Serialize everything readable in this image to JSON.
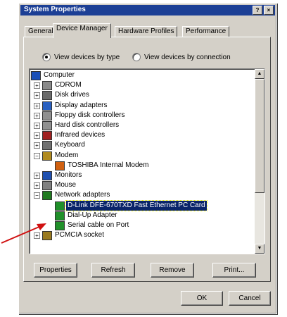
{
  "window": {
    "title": "System Properties",
    "help_button": "?",
    "close_button": "×"
  },
  "tabs": [
    {
      "label": "General"
    },
    {
      "label": "Device Manager",
      "active": true
    },
    {
      "label": "Hardware Profiles"
    },
    {
      "label": "Performance"
    }
  ],
  "view_options": {
    "by_type": {
      "label": "View devices by type",
      "selected": true
    },
    "by_connection": {
      "label": "View devices by connection",
      "selected": false
    }
  },
  "tree": {
    "items": [
      {
        "label": "Computer",
        "icon": "computer-icon",
        "expander": ""
      },
      {
        "label": "CDROM",
        "icon": "cdrom-icon",
        "expander": "+"
      },
      {
        "label": "Disk drives",
        "icon": "disk-drive-icon",
        "expander": "+"
      },
      {
        "label": "Display adapters",
        "icon": "display-adapter-icon",
        "expander": "+"
      },
      {
        "label": "Floppy disk controllers",
        "icon": "floppy-controller-icon",
        "expander": "+"
      },
      {
        "label": "Hard disk controllers",
        "icon": "hard-disk-controller-icon",
        "expander": "+"
      },
      {
        "label": "Infrared devices",
        "icon": "infrared-icon",
        "expander": "+"
      },
      {
        "label": "Keyboard",
        "icon": "keyboard-icon",
        "expander": "+"
      },
      {
        "label": "Modem",
        "icon": "modem-icon",
        "expander": "−"
      },
      {
        "label": "TOSHIBA Internal Modem",
        "icon": "modem-device-icon",
        "expander": ""
      },
      {
        "label": "Monitors",
        "icon": "monitor-icon",
        "expander": "+"
      },
      {
        "label": "Mouse",
        "icon": "mouse-icon",
        "expander": "+"
      },
      {
        "label": "Network adapters",
        "icon": "network-adapter-icon",
        "expander": "−"
      },
      {
        "label": "D-Link DFE-670TXD Fast Ethernet PC Card",
        "icon": "network-card-icon",
        "expander": "",
        "selected": true
      },
      {
        "label": "Dial-Up Adapter",
        "icon": "network-card-icon",
        "expander": ""
      },
      {
        "label": "Serial cable on Port",
        "icon": "network-card-icon",
        "expander": ""
      },
      {
        "label": "PCMCIA socket",
        "icon": "pcmcia-icon",
        "expander": "+"
      }
    ]
  },
  "buttons": {
    "properties": "Properties",
    "refresh": "Refresh",
    "remove": "Remove",
    "print": "Print...",
    "ok": "OK",
    "cancel": "Cancel"
  },
  "colors": {
    "title_bar": "#1c3f95",
    "selection": "#0a246a",
    "annotation_arrow": "#d01010"
  }
}
